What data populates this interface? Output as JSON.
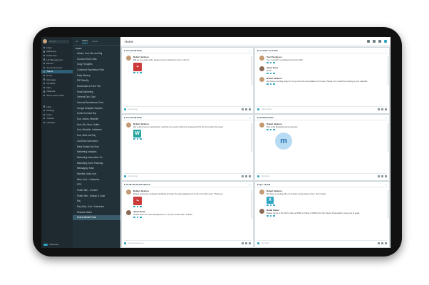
{
  "sidebar": {
    "search_placeholder": "Jump to...",
    "items": [
      "Inbox",
      "Marketing",
      "Public Site",
      "UX Management",
      "Recent",
      "Announcements",
      "Teams",
      "Email",
      "Messages",
      "Contacts",
      "Files",
      "Calendar",
      "Show Online Staff"
    ],
    "active_index": 6,
    "bottom": [
      "Help",
      "Settings",
      "Invite",
      "Tutorial",
      "Help Bot"
    ],
    "toggle_label": "Subscribe"
  },
  "col2": {
    "tabs": [
      "All",
      "Topics",
      "People"
    ],
    "active_tab": 1,
    "header": "Topics",
    "items": [
      "Admin, Kurt, Mic and Raj",
      "Concord Kid & Kids",
      "Copy Thoughts",
      "Customer Experience Plan",
      "Daily Meetup",
      "FBT/StarSy",
      "Downloads & Form Filo",
      "Email Marketing",
      "General Dev Chat",
      "General Workstream Chat",
      "Google Analytics Reports",
      "Kurtis Kurt and Raj",
      "Kurt, Adrian, Michelle",
      "Kurt, Mic, Bron, Kathe...",
      "Kurt, Michelle, Katherine",
      "Kurt, Mick and Raj",
      "LiveChat Connection",
      "Meta Emails Not Sure",
      "Marketing Analytics",
      "Marketing Automation To...",
      "Marketing Event Planning",
      "Messaging Team",
      "Michelle, Matt, Kurt",
      "Mick, Kurt + Katherine",
      "PPC",
      "Public Site - Content",
      "Public Site - Design & Code",
      "Raj",
      "Raj, Mick, Kurt + Katherine",
      "Release Notes",
      "Social Media Posts"
    ],
    "active_index": 30
  },
  "topbar": {
    "title": "Home"
  },
  "panels": [
    {
      "title": "ACCOUNTING",
      "messages": [
        {
          "name": "Robert Jackson",
          "text": "Did we see under audit, please need a conference room in 30 min",
          "type": "pdf"
        }
      ],
      "composer": "Accounting"
    },
    {
      "title": "CLIENT ACTION",
      "messages": [
        {
          "name": "Tom Thompson",
          "text": "Yes - we will be completed tomorrow 2 EM"
        },
        {
          "name": "Joyce Ross",
          "text": "Great"
        },
        {
          "name": "Robert Jackson",
          "text": "We have a meeting today at 3 to go over the new updates to the case. Please sure to add the meeting to your calendar."
        }
      ],
      "composer": "Client Action"
    },
    {
      "title": "ACCOUNTING",
      "messages": [
        {
          "name": "Robert Jackson",
          "text": "We need to have a meeting first, and then we need to finish the meeting and the first to be done this week",
          "type": "doc"
        }
      ],
      "composer": "Accounting"
    },
    {
      "title": "MARKETING",
      "messages": [
        {
          "name": "Robert Jackson",
          "text": "This is the Marketing announcement"
        }
      ],
      "composer": "Marketing"
    },
    {
      "title": "HUMAN RESOURCES",
      "messages": [
        {
          "name": "Robert Jackson",
          "text": "Please review the employee handbook and sign the acknowledgement by the end of the week. Thank you",
          "type": "pdf"
        },
        {
          "name": "Jason Scott",
          "text": "Please return the acknowledgement to me by the Leslie date. Thanks!"
        }
      ],
      "composer": "Human Resources"
    },
    {
      "title": "QC TEAM",
      "messages": [
        {
          "name": "Robert Jackson",
          "text": "We have a meeting with our Investor group today at 4pm, don't forget!",
          "type": "x"
        },
        {
          "name": "Bridal Parker",
          "text": "Please report to the CFO's office at 3PM on Friday in FRB for the QC Report Presentation. Keep your & goals."
        }
      ],
      "composer": "QC Team"
    }
  ]
}
